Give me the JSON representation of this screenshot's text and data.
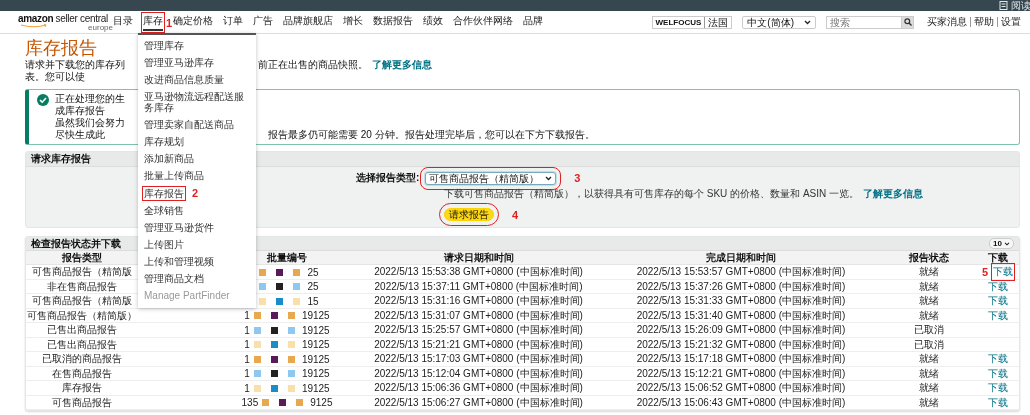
{
  "top_bar": {
    "reader_label": "阅读"
  },
  "header": {
    "logo": {
      "brand": "amazon",
      "product": "seller central",
      "region": "europe"
    },
    "nav": [
      {
        "label": "目录",
        "selected": false
      },
      {
        "label": "库存",
        "selected": true,
        "callout": "1"
      },
      {
        "label": "确定价格",
        "selected": false
      },
      {
        "label": "订单",
        "selected": false
      },
      {
        "label": "广告",
        "selected": false
      },
      {
        "label": "品牌旗舰店",
        "selected": false
      },
      {
        "label": "增长",
        "selected": false
      },
      {
        "label": "数据报告",
        "selected": false
      },
      {
        "label": "绩效",
        "selected": false
      },
      {
        "label": "合作伙伴网络",
        "selected": false
      },
      {
        "label": "品牌",
        "selected": false
      }
    ],
    "account": {
      "name": "WELFOCUS",
      "region": "法国"
    },
    "language": "中文(简体)",
    "search": {
      "placeholder": "搜索"
    },
    "links": [
      "买家消息",
      "帮助",
      "设置"
    ]
  },
  "menu": {
    "items": [
      {
        "label": "管理库存",
        "disabled": false
      },
      {
        "label": "管理亚马逊库存",
        "disabled": false
      },
      {
        "label": "改进商品信息质量",
        "disabled": false
      },
      {
        "label": "亚马逊物流远程配送服务库存",
        "disabled": false
      },
      {
        "label": "管理卖家自配送商品",
        "disabled": false
      },
      {
        "label": "库存规划",
        "disabled": false
      },
      {
        "label": "添加新商品",
        "disabled": false
      },
      {
        "label": "批量上传商品",
        "disabled": false
      },
      {
        "label": "库存报告",
        "disabled": false,
        "callout": "2"
      },
      {
        "label": "全球销售",
        "disabled": false
      },
      {
        "label": "管理亚马逊货件",
        "disabled": false
      },
      {
        "label": "上传图片",
        "disabled": false
      },
      {
        "label": "上传和管理视频",
        "disabled": false
      },
      {
        "label": "管理商品文档",
        "disabled": false
      },
      {
        "label": "Manage PartFinder",
        "disabled": true
      }
    ]
  },
  "page": {
    "title": "库存报告",
    "intro": {
      "left": "请求并下载您的库存列表。您可以使",
      "right": "前正在出售的商品快照。",
      "link": "了解更多信息"
    },
    "alert": {
      "line1_left": "正在处理您的生成库存报告",
      "line2_left": "虽然我们会努力尽快生成此",
      "line2_right": "报告最多仍可能需要 20 分钟。报告处理完毕后，您可以在下方下载报告。"
    }
  },
  "request": {
    "title": "请求库存报告",
    "type_label": "选择报告类型:",
    "type_value": "可售商品报告（精简版）",
    "type_callout": "3",
    "description": "下载可售商品报告（精简版），以获得具有可售库存的每个 SKU 的价格、数量和 ASIN 一览。",
    "link": "了解更多信息",
    "button": "请求报告",
    "button_callout": "4"
  },
  "reports": {
    "title": "检查报告状态并下载",
    "page_size": "10",
    "columns": [
      "报告类型",
      "批量编号",
      "请求日期和时间",
      "完成日期和时间",
      "报告状态",
      "下载"
    ],
    "rows": [
      {
        "type": "可售商品报告（精简版",
        "batch_end": "25",
        "requested": "2022/5/13 15:53:38 GMT+0800 (中国标准时间)",
        "completed": "2022/5/13 15:53:57 GMT+0800 (中国标准时间)",
        "status": "就绪",
        "download": "下载",
        "callout": "5"
      },
      {
        "type": "非在售商品报告",
        "batch_end": "25",
        "requested": "2022/5/13 15:37:11 GMT+0800 (中国标准时间)",
        "completed": "2022/5/13 15:37:26 GMT+0800 (中国标准时间)",
        "status": "就绪",
        "download": "下载"
      },
      {
        "type": "可售商品报告（精简版",
        "batch_end": "15",
        "requested": "2022/5/13 15:31:16 GMT+0800 (中国标准时间)",
        "completed": "2022/5/13 15:31:33 GMT+0800 (中国标准时间)",
        "status": "就绪",
        "download": "下载"
      },
      {
        "type": "可售商品报告（精简版）",
        "batch_start": "1",
        "batch_end": "19125",
        "requested": "2022/5/13 15:31:07 GMT+0800 (中国标准时间)",
        "completed": "2022/5/13 15:31:40 GMT+0800 (中国标准时间)",
        "status": "就绪",
        "download": "下载"
      },
      {
        "type": "已售出商品报告",
        "batch_start": "1",
        "batch_end": "19125",
        "requested": "2022/5/13 15:25:57 GMT+0800 (中国标准时间)",
        "completed": "2022/5/13 15:26:09 GMT+0800 (中国标准时间)",
        "status": "已取消"
      },
      {
        "type": "已售出商品报告",
        "batch_start": "1",
        "batch_end": "19125",
        "requested": "2022/5/13 15:21:21 GMT+0800 (中国标准时间)",
        "completed": "2022/5/13 15:21:32 GMT+0800 (中国标准时间)",
        "status": "已取消"
      },
      {
        "type": "已取消的商品报告",
        "batch_start": "1",
        "batch_end": "19125",
        "requested": "2022/5/13 15:17:03 GMT+0800 (中国标准时间)",
        "completed": "2022/5/13 15:17:18 GMT+0800 (中国标准时间)",
        "status": "就绪",
        "download": "下载"
      },
      {
        "type": "在售商品报告",
        "batch_start": "1",
        "batch_end": "19125",
        "requested": "2022/5/13 15:12:04 GMT+0800 (中国标准时间)",
        "completed": "2022/5/13 15:12:21 GMT+0800 (中国标准时间)",
        "status": "就绪",
        "download": "下载"
      },
      {
        "type": "库存报告",
        "batch_start": "1",
        "batch_end": "19125",
        "requested": "2022/5/13 15:06:36 GMT+0800 (中国标准时间)",
        "completed": "2022/5/13 15:06:52 GMT+0800 (中国标准时间)",
        "status": "就绪",
        "download": "下载"
      },
      {
        "type": "可售商品报告",
        "batch_start": "135",
        "batch_end": "9125",
        "requested": "2022/5/13 15:06:27 GMT+0800 (中国标准时间)",
        "completed": "2022/5/13 15:06:43 GMT+0800 (中国标准时间)",
        "status": "就绪",
        "download": "下载"
      }
    ]
  }
}
